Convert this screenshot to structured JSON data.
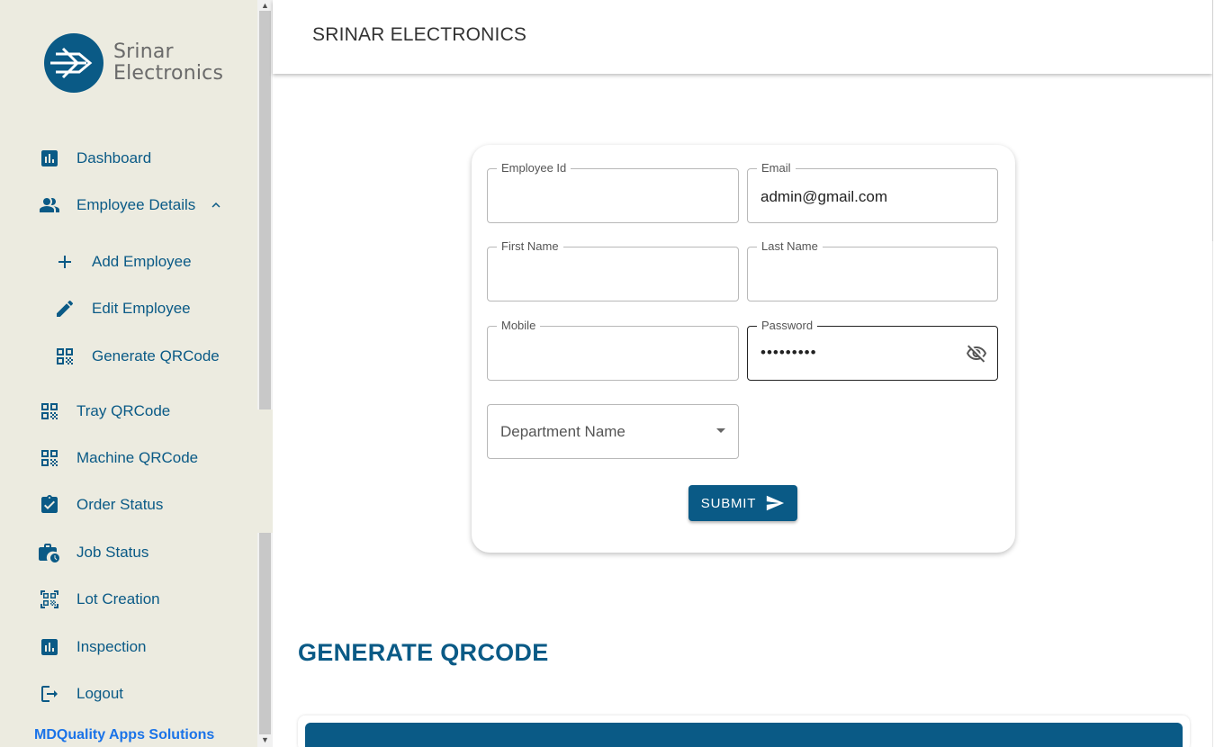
{
  "brand": {
    "logo_line1": "Srinar",
    "logo_line2": "Electronics",
    "footer": "MDQuality Apps Solutions"
  },
  "header": {
    "title": "SRINAR ELECTRONICS"
  },
  "sidebar": {
    "items": [
      {
        "label": "Dashboard",
        "icon": "bar-chart-icon"
      },
      {
        "label": "Employee Details",
        "icon": "people-icon",
        "expanded": true
      },
      {
        "label": "Add Employee",
        "icon": "plus-icon"
      },
      {
        "label": "Edit Employee",
        "icon": "pencil-icon"
      },
      {
        "label": "Generate QRCode",
        "icon": "qr-icon"
      },
      {
        "label": "Tray QRCode",
        "icon": "qr-icon"
      },
      {
        "label": "Machine QRCode",
        "icon": "qr-icon"
      },
      {
        "label": "Order Status",
        "icon": "clipboard-check-icon"
      },
      {
        "label": "Job Status",
        "icon": "work-history-icon"
      },
      {
        "label": "Lot Creation",
        "icon": "qr-scan-icon"
      },
      {
        "label": "Inspection",
        "icon": "bar-chart-icon"
      },
      {
        "label": "Logout",
        "icon": "logout-icon"
      }
    ]
  },
  "form": {
    "employee_id": {
      "label": "Employee Id",
      "value": ""
    },
    "email": {
      "label": "Email",
      "value": "admin@gmail.com"
    },
    "first_name": {
      "label": "First Name",
      "value": ""
    },
    "last_name": {
      "label": "Last Name",
      "value": ""
    },
    "mobile": {
      "label": "Mobile",
      "value": ""
    },
    "password": {
      "label": "Password",
      "value": "•••••••••"
    },
    "department": {
      "placeholder": "Department Name"
    },
    "submit_label": "SUBMIT"
  },
  "section": {
    "title": "GENERATE QRCODE"
  },
  "colors": {
    "primary": "#0a5a86",
    "sidebar_bg": "#ecebe0",
    "footer_brand": "#1a73e8"
  }
}
